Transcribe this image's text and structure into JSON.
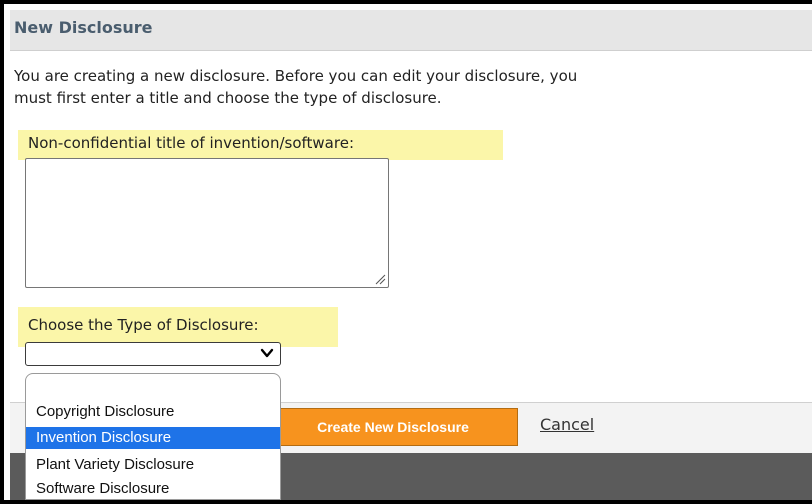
{
  "dialog": {
    "title": "New Disclosure",
    "intro_line1": "You are creating a new disclosure. Before you can edit your disclosure, you",
    "intro_line2": "must first enter a title and choose the type of disclosure.",
    "title_label": "Non-confidential title of invention/software:",
    "title_value": "",
    "type_label": "Choose the Type of Disclosure:",
    "type_selected": ""
  },
  "dropdown": {
    "options": [
      "Copyright Disclosure",
      "Invention Disclosure",
      "Plant Variety Disclosure",
      "Software Disclosure"
    ],
    "highlighted_index": 1
  },
  "footer": {
    "create_label": "Create New Disclosure",
    "cancel_label": "Cancel"
  },
  "colors": {
    "title_bar": "#e6e6e6",
    "highlight": "#fbf6a9",
    "primary_button": "#f7931e",
    "option_selected": "#1e73e8"
  },
  "icons": [
    "chevron-down-icon",
    "resize-grip-icon"
  ]
}
